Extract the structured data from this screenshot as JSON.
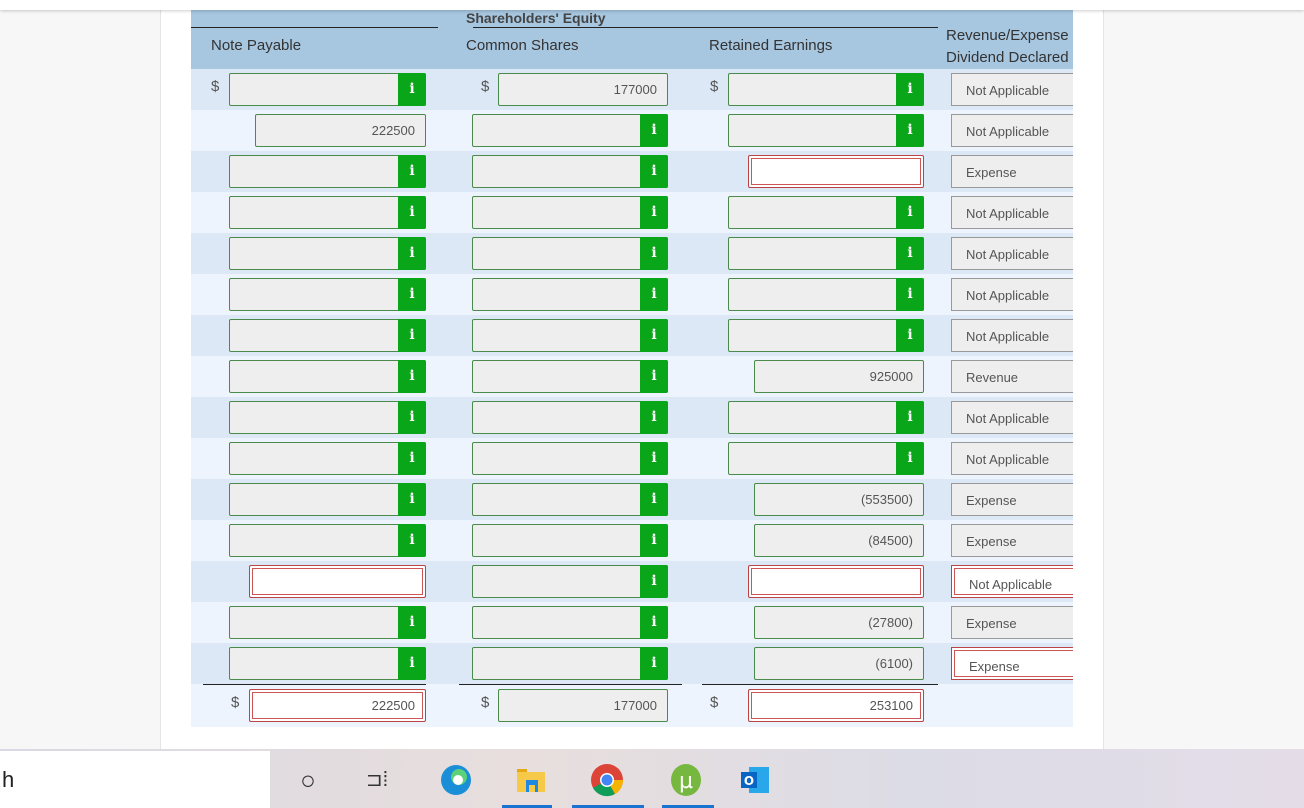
{
  "header": {
    "group": "Shareholders' Equity",
    "columns": [
      "Note Payable",
      "Common Shares",
      "Retained Earnings",
      "Revenue/Expense Dividend Declared"
    ],
    "type_col_line1": "Revenue/Expense",
    "type_col_line2": "Dividend Declared"
  },
  "currency": "$",
  "info_label": "i",
  "rows": [
    {
      "np": {
        "kind": "info",
        "value": "",
        "dollar": true
      },
      "cs": {
        "kind": "plain",
        "value": "177000",
        "dollar": true
      },
      "re": {
        "kind": "info",
        "value": "",
        "dollar": true
      },
      "type": {
        "value": "Not Applicable",
        "error": false
      }
    },
    {
      "np": {
        "kind": "plain",
        "value": "222500"
      },
      "cs": {
        "kind": "info",
        "value": ""
      },
      "re": {
        "kind": "info",
        "value": ""
      },
      "type": {
        "value": "Not Applicable",
        "error": false
      }
    },
    {
      "np": {
        "kind": "info",
        "value": ""
      },
      "cs": {
        "kind": "info",
        "value": ""
      },
      "re": {
        "kind": "error",
        "value": ""
      },
      "type": {
        "value": "Expense",
        "error": false
      }
    },
    {
      "np": {
        "kind": "info",
        "value": ""
      },
      "cs": {
        "kind": "info",
        "value": ""
      },
      "re": {
        "kind": "info",
        "value": ""
      },
      "type": {
        "value": "Not Applicable",
        "error": false
      }
    },
    {
      "np": {
        "kind": "info",
        "value": ""
      },
      "cs": {
        "kind": "info",
        "value": ""
      },
      "re": {
        "kind": "info",
        "value": ""
      },
      "type": {
        "value": "Not Applicable",
        "error": false
      }
    },
    {
      "np": {
        "kind": "info",
        "value": ""
      },
      "cs": {
        "kind": "info",
        "value": ""
      },
      "re": {
        "kind": "info",
        "value": ""
      },
      "type": {
        "value": "Not Applicable",
        "error": false
      }
    },
    {
      "np": {
        "kind": "info",
        "value": ""
      },
      "cs": {
        "kind": "info",
        "value": ""
      },
      "re": {
        "kind": "info",
        "value": ""
      },
      "type": {
        "value": "Not Applicable",
        "error": false
      }
    },
    {
      "np": {
        "kind": "info",
        "value": ""
      },
      "cs": {
        "kind": "info",
        "value": ""
      },
      "re": {
        "kind": "plain",
        "value": "925000"
      },
      "type": {
        "value": "Revenue",
        "error": false
      }
    },
    {
      "np": {
        "kind": "info",
        "value": ""
      },
      "cs": {
        "kind": "info",
        "value": ""
      },
      "re": {
        "kind": "info",
        "value": ""
      },
      "type": {
        "value": "Not Applicable",
        "error": false
      }
    },
    {
      "np": {
        "kind": "info",
        "value": ""
      },
      "cs": {
        "kind": "info",
        "value": ""
      },
      "re": {
        "kind": "info",
        "value": ""
      },
      "type": {
        "value": "Not Applicable",
        "error": false
      }
    },
    {
      "np": {
        "kind": "info",
        "value": ""
      },
      "cs": {
        "kind": "info",
        "value": ""
      },
      "re": {
        "kind": "plain",
        "value": "(553500)"
      },
      "type": {
        "value": "Expense",
        "error": false
      }
    },
    {
      "np": {
        "kind": "info",
        "value": ""
      },
      "cs": {
        "kind": "info",
        "value": ""
      },
      "re": {
        "kind": "plain",
        "value": "(84500)"
      },
      "type": {
        "value": "Expense",
        "error": false
      }
    },
    {
      "np": {
        "kind": "error",
        "value": ""
      },
      "cs": {
        "kind": "info",
        "value": ""
      },
      "re": {
        "kind": "error",
        "value": ""
      },
      "type": {
        "value": "Not Applicable",
        "error": true
      }
    },
    {
      "np": {
        "kind": "info",
        "value": ""
      },
      "cs": {
        "kind": "info",
        "value": ""
      },
      "re": {
        "kind": "plain",
        "value": "(27800)"
      },
      "type": {
        "value": "Expense",
        "error": false
      }
    },
    {
      "np": {
        "kind": "info",
        "value": ""
      },
      "cs": {
        "kind": "info",
        "value": ""
      },
      "re": {
        "kind": "plain",
        "value": "(6100)"
      },
      "type": {
        "value": "Expense",
        "error": true
      }
    }
  ],
  "totals": {
    "np": {
      "kind": "error",
      "value": "222500",
      "dollar": true
    },
    "cs": {
      "kind": "plain",
      "value": "177000",
      "dollar": true
    },
    "re": {
      "kind": "error",
      "value": "253100",
      "dollar": true
    }
  },
  "taskbar": {
    "search_text": "h",
    "apps": [
      "cortana-icon",
      "task-view-icon",
      "edge-icon",
      "file-explorer-icon",
      "chrome-icon",
      "utorrent-icon",
      "outlook-icon"
    ]
  },
  "colors": {
    "header_bg": "#a7c6df",
    "info_green": "#0aa619",
    "error_red": "#c55",
    "row_dark": "#dde8f6",
    "row_light": "#edf4fd"
  }
}
